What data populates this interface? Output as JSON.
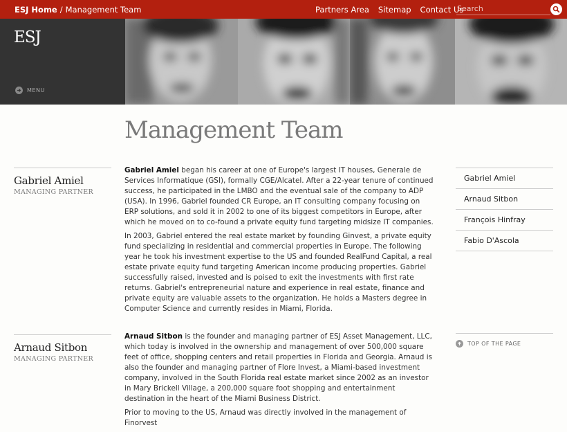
{
  "breadcrumb": {
    "home": "ESJ Home",
    "separator": "/",
    "current": "Management Team"
  },
  "nav": {
    "links": [
      "Partners Area",
      "Sitemap",
      "Contact Us"
    ]
  },
  "search": {
    "placeholder": "Search"
  },
  "brand": {
    "logo": "ESJ",
    "menu_label": "MENU"
  },
  "page": {
    "title": "Management Team"
  },
  "people": [
    {
      "name": "Gabriel Amiel",
      "role": "MANAGING PARTNER",
      "bio": [
        {
          "lead": "Gabriel Amiel",
          "text": " began his career at one of Europe's largest IT houses, Generale de Services Informatique (GSI), formally CGE/Alcatel. After a 22-year tenure of continued success, he participated in the LMBO and the eventual sale of the company to ADP (USA). In 1996, Gabriel founded CR Europe, an IT consulting company focusing on ERP solutions, and sold it in 2002 to one of its biggest competitors in Europe, after which he moved on to co-found a private equity fund targeting midsize IT companies."
        },
        {
          "lead": "",
          "text": "In 2003, Gabriel entered the real estate market by founding Ginvest, a private equity fund specializing in residential and commercial properties in Europe. The following year he took his investment expertise to the US and founded RealFund Capital, a real estate private equity fund targeting American income producing properties. Gabriel successfully raised, invested and is poised to exit the investments with first rate returns. Gabriel's entrepreneurial nature and experience in real estate, finance and private equity are valuable assets to the organization. He holds a Masters degree in Computer Science and currently resides in Miami, Florida."
        }
      ]
    },
    {
      "name": "Arnaud Sitbon",
      "role": "MANAGING PARTNER",
      "bio": [
        {
          "lead": "Arnaud Sitbon",
          "text": " is the founder and managing partner of ESJ Asset Management, LLC, which today is involved in the ownership and management of over 500,000 square feet of office, shopping centers and retail properties in Florida and Georgia. Arnaud is also the founder and managing partner of Flore Invest, a Miami-based investment company, involved in the South Florida real estate market since 2002 as an investor in Mary Brickell Village, a 200,000 square foot shopping and entertainment destination in the heart of the Miami Business District."
        },
        {
          "lead": "",
          "text": "Prior to moving to the US, Arnaud was directly involved in the management of Finorvest"
        }
      ]
    }
  ],
  "side_list": [
    "Gabriel Amiel",
    "Arnaud Sitbon",
    "François Hinfray",
    "Fabio D'Ascola"
  ],
  "top_of_page": "TOP OF THE PAGE",
  "colors": {
    "accent": "#b3200f",
    "brand_bg": "#333333"
  }
}
